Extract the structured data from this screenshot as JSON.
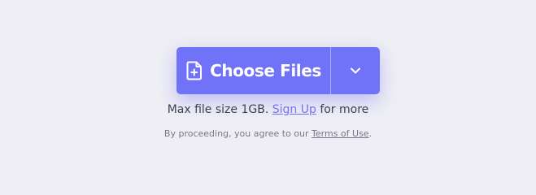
{
  "upload": {
    "button_label": "Choose Files",
    "icon": "file-add-icon",
    "dropdown_icon": "chevron-down-icon",
    "accent_color": "#7072f7"
  },
  "limits": {
    "prefix": "Max file size 1GB.",
    "signup_label": "Sign Up",
    "suffix": "for more"
  },
  "legal": {
    "prefix": "By proceeding, you agree to our",
    "terms_label": "Terms of Use",
    "suffix": "."
  }
}
